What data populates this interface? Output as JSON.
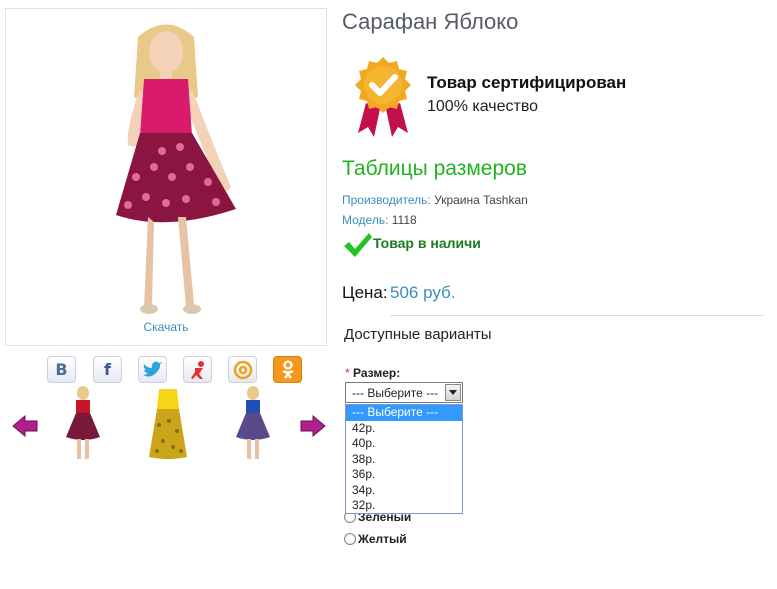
{
  "product": {
    "title": "Сарафан Яблоко",
    "download_label": "Скачать"
  },
  "certificate": {
    "title": "Товар сертифицирован",
    "subtitle": "100% качество",
    "icon": "certified-badge-icon"
  },
  "size_table_link": "Таблицы размеров",
  "info": {
    "manufacturer_label": "Производитель:",
    "manufacturer_value": "Украина Tashkan",
    "model_label": "Модель:",
    "model_value": "1118"
  },
  "stock": {
    "text": "Товар в наличи",
    "icon": "checkmark-icon"
  },
  "price": {
    "label": "Цена:",
    "value": "506 руб."
  },
  "variants": {
    "title": "Доступные варианты",
    "size_required_mark": "*",
    "size_label": "Размер:",
    "select_value": "--- Выберите ---",
    "options": [
      "--- Выберите ---",
      "42р.",
      "40р.",
      "38р.",
      "36р.",
      "34р.",
      "32р."
    ],
    "colors": [
      "Зеленый",
      "Желтый"
    ]
  },
  "share_icons": [
    "vk-icon",
    "facebook-icon",
    "twitter-icon",
    "moikrug-icon",
    "mailru-icon",
    "odnoklassniki-icon"
  ],
  "colors": {
    "accent_blue": "#3b8dbd",
    "accent_green": "#22b322",
    "stock_green": "#1f7a1f",
    "title_gray": "#555c66",
    "selected_option": "#3399ff",
    "arrow_magenta": "#b0208a"
  }
}
